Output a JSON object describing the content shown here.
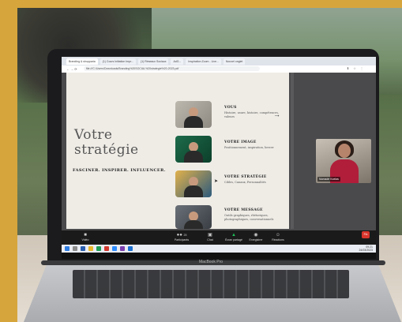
{
  "browser": {
    "tabs": [
      {
        "label": "Branding & shopparia"
      },
      {
        "label": "(1) Cours Initiation Impr..."
      },
      {
        "label": "(1) Réseaux Sociaux"
      },
      {
        "label": "AdG..."
      },
      {
        "label": "Inspiration Zoom - Live..."
      },
      {
        "label": "Nouvel onglet"
      }
    ],
    "url": "file:///C:/Users/Downloads/Branding%20SOCIAL%20strategie%20-2023.pdf"
  },
  "slide": {
    "title_line1": "Votre",
    "title_line2": "stratégie",
    "subtitle": "FASCINER. INSPIRER. INFLUENCER.",
    "sections": [
      {
        "heading": "VOUS",
        "desc": "Histoire, usure, histoire, compétences, valeurs"
      },
      {
        "heading": "VOTRE IMAGE",
        "desc": "Positionnement, inspiration, bercer"
      },
      {
        "heading": "VOTRE STRATÉGIE",
        "desc": "Cibles, Canaux, Personnalités"
      },
      {
        "heading": "VOTRE MESSAGE",
        "desc": "Outils graphiques, rhétoriques, photographiques, conversationnels"
      }
    ]
  },
  "video": {
    "participant_name": "Nomade Koelas"
  },
  "zoom_toolbar": {
    "items": [
      {
        "label": "Vidéo"
      },
      {
        "label": "Participants",
        "count": "25"
      },
      {
        "label": "Chat"
      },
      {
        "label": "Écran partagé"
      },
      {
        "label": "Enregistrer"
      },
      {
        "label": "Réactions"
      }
    ],
    "end_label": "Fin"
  },
  "taskbar": {
    "time": "09:21",
    "date": "24/03/2023"
  },
  "device": {
    "brand": "MacBook Pro"
  },
  "colors": {
    "frame": "#d6a53c",
    "zoom_share": "#1fbf5a",
    "end_button": "#d9352c"
  }
}
